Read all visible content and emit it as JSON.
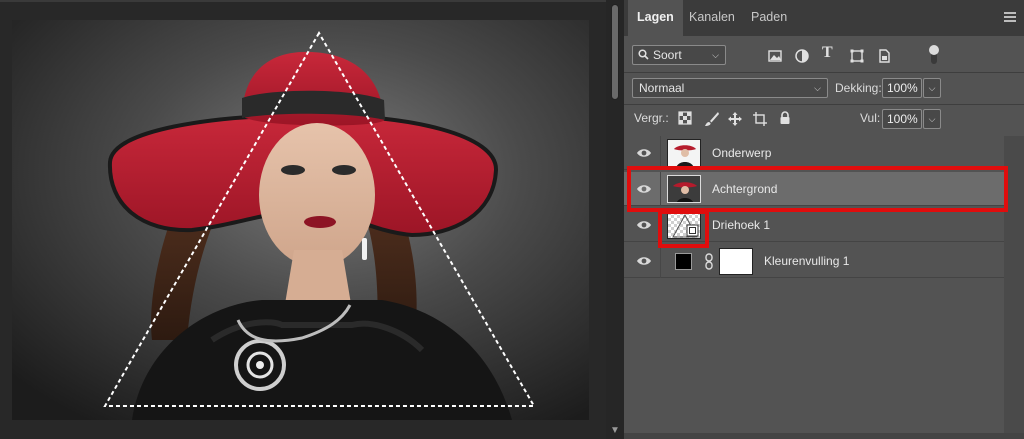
{
  "panel": {
    "tabs": [
      {
        "label": "Lagen",
        "active": true
      },
      {
        "label": "Kanalen",
        "active": false
      },
      {
        "label": "Paden",
        "active": false
      }
    ],
    "filter": {
      "label": "Soort"
    },
    "blend_mode": "Normaal",
    "opacity_label": "Dekking:",
    "opacity_value": "100%",
    "lock_label": "Vergr.:",
    "fill_label": "Vul:",
    "fill_value": "100%"
  },
  "layers": [
    {
      "name": "Onderwerp",
      "selected": false,
      "thumb": "portrait-cutout"
    },
    {
      "name": "Achtergrond",
      "selected": true,
      "thumb": "portrait-full"
    },
    {
      "name": "Driehoek 1",
      "selected": false,
      "thumb": "shape-layer"
    },
    {
      "name": "Kleurenvulling 1",
      "selected": false,
      "thumb": "fill-layer"
    }
  ],
  "colors": {
    "highlight_red": "#e00d0d",
    "panel_bg": "#535353",
    "selected_row": "#6c6c6c"
  },
  "icons": [
    "search-icon",
    "pixel-filter-icon",
    "adjustment-filter-icon",
    "type-filter-icon",
    "shape-filter-icon",
    "smartobject-filter-icon",
    "filter-toggle-icon",
    "lock-pixels-icon",
    "lock-paint-icon",
    "lock-move-icon",
    "lock-artboard-icon",
    "lock-all-icon",
    "eye-icon",
    "link-icon",
    "panel-menu-icon"
  ]
}
